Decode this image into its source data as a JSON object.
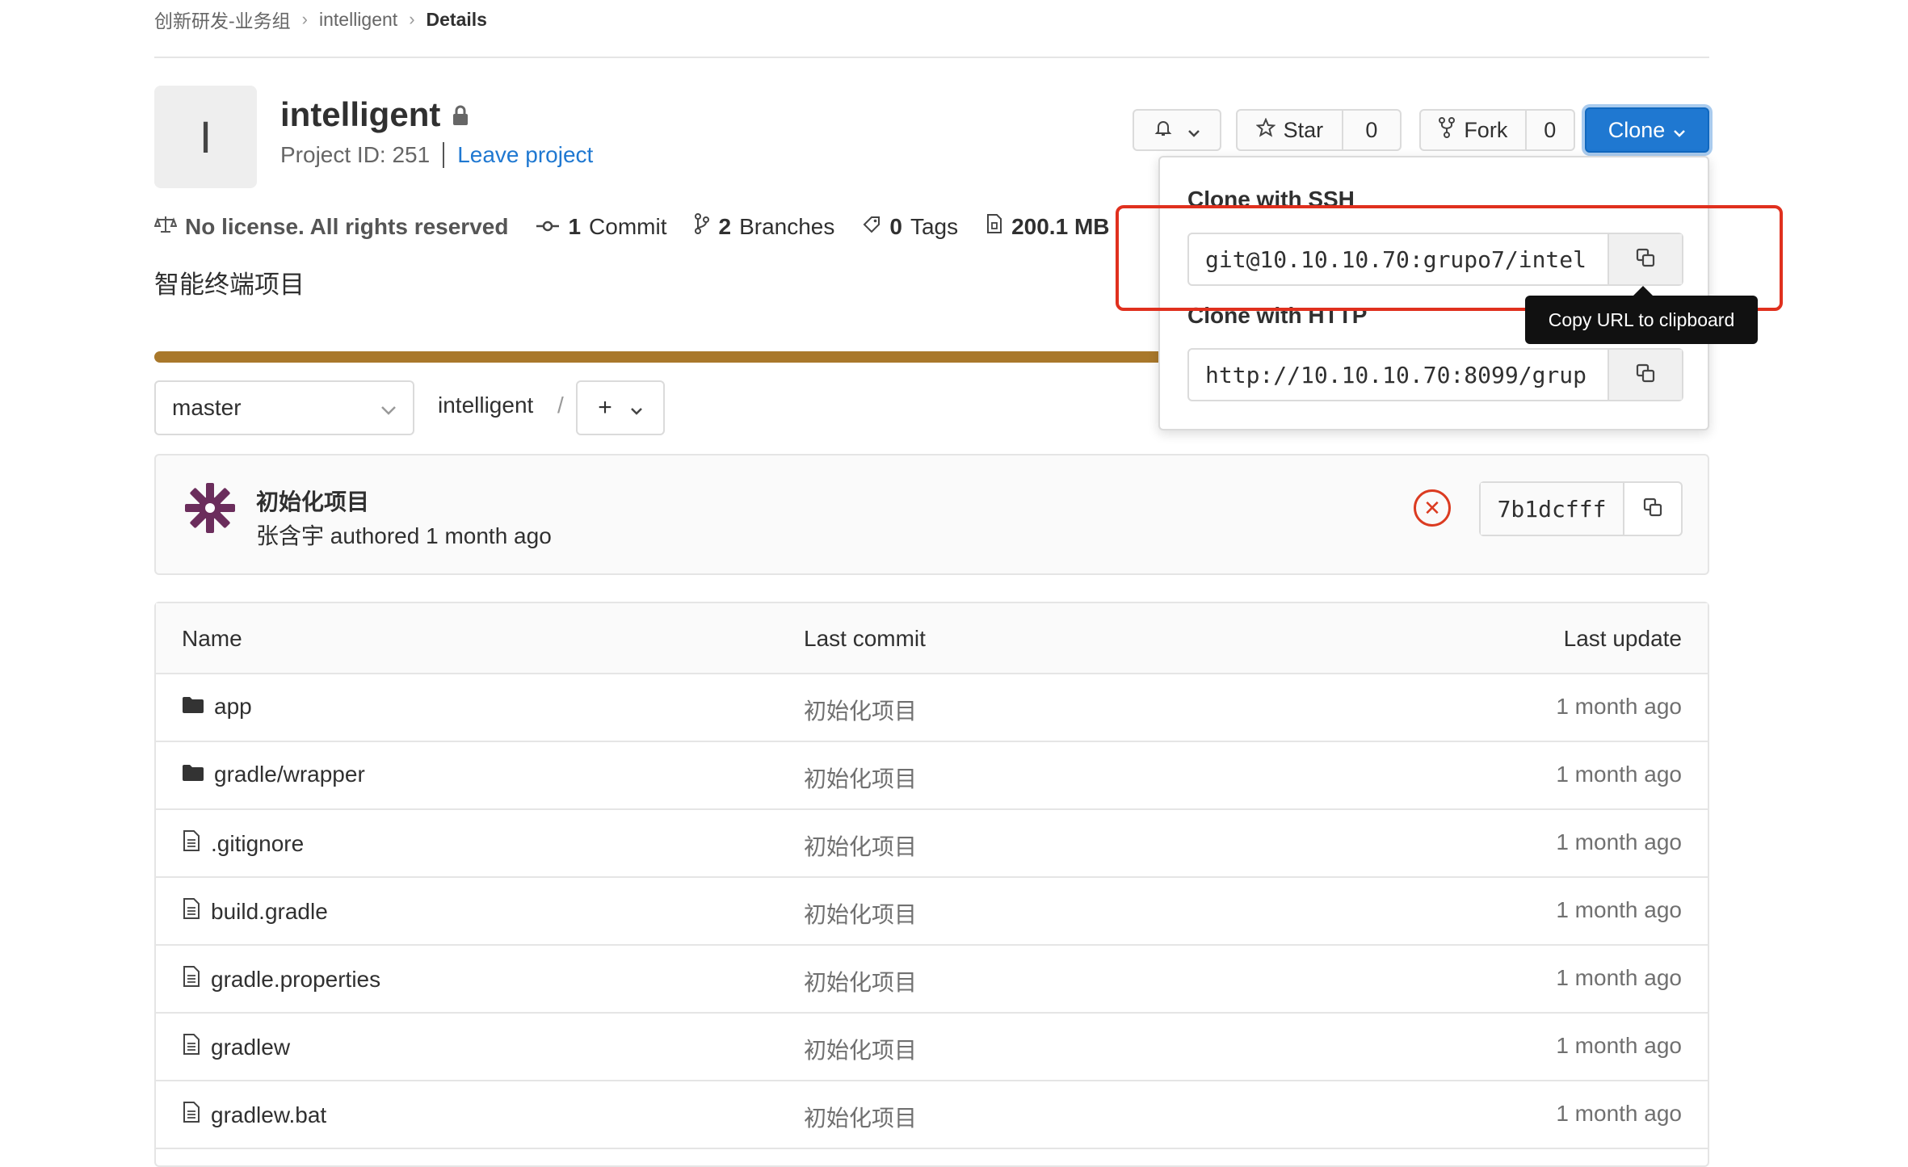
{
  "breadcrumb": {
    "group": "创新研发-业务组",
    "project": "intelligent",
    "current": "Details"
  },
  "project": {
    "avatar_letter": "I",
    "name": "intelligent",
    "id_text": "Project ID: 251",
    "leave_label": "Leave project",
    "description": "智能终端项目",
    "language_color": "#a9782b"
  },
  "header_buttons": {
    "star_label": "Star",
    "star_count": "0",
    "fork_label": "Fork",
    "fork_count": "0",
    "clone_label": "Clone"
  },
  "stats": {
    "license": "No license. All rights reserved",
    "commits_num": "1",
    "commits_label": "Commit",
    "branches_num": "2",
    "branches_label": "Branches",
    "tags_num": "0",
    "tags_label": "Tags",
    "size_text": "200.1 MB"
  },
  "branch_bar": {
    "branch": "master",
    "path": "intelligent",
    "separator": "/",
    "add_symbol": "+"
  },
  "commit": {
    "title": "初始化项目",
    "author_line": "张含宇 authored 1 month ago",
    "sha": "7b1dcfff",
    "status": "failed",
    "status_color": "#db3b21"
  },
  "table": {
    "headers": {
      "name": "Name",
      "last_commit": "Last commit",
      "last_update": "Last update"
    },
    "rows": [
      {
        "name": "app",
        "icon": "folder-icon",
        "commit": "初始化项目",
        "updated": "1 month ago"
      },
      {
        "name": "gradle/wrapper",
        "icon": "folder-icon",
        "commit": "初始化项目",
        "updated": "1 month ago"
      },
      {
        "name": ".gitignore",
        "icon": "file-icon",
        "commit": "初始化项目",
        "updated": "1 month ago"
      },
      {
        "name": "build.gradle",
        "icon": "file-icon",
        "commit": "初始化项目",
        "updated": "1 month ago"
      },
      {
        "name": "gradle.properties",
        "icon": "file-icon",
        "commit": "初始化项目",
        "updated": "1 month ago"
      },
      {
        "name": "gradlew",
        "icon": "file-icon",
        "commit": "初始化项目",
        "updated": "1 month ago"
      },
      {
        "name": "gradlew.bat",
        "icon": "file-icon",
        "commit": "初始化项目",
        "updated": "1 month ago"
      }
    ]
  },
  "clone_dropdown": {
    "ssh_label": "Clone with SSH",
    "ssh_url": "git@10.10.10.70:grupo7/intel",
    "http_label": "Clone with HTTP",
    "http_url": "http://10.10.10.70:8099/grup",
    "tooltip": "Copy URL to clipboard"
  },
  "colors": {
    "accent": "#1f78d1",
    "highlight": "#e0301e"
  }
}
